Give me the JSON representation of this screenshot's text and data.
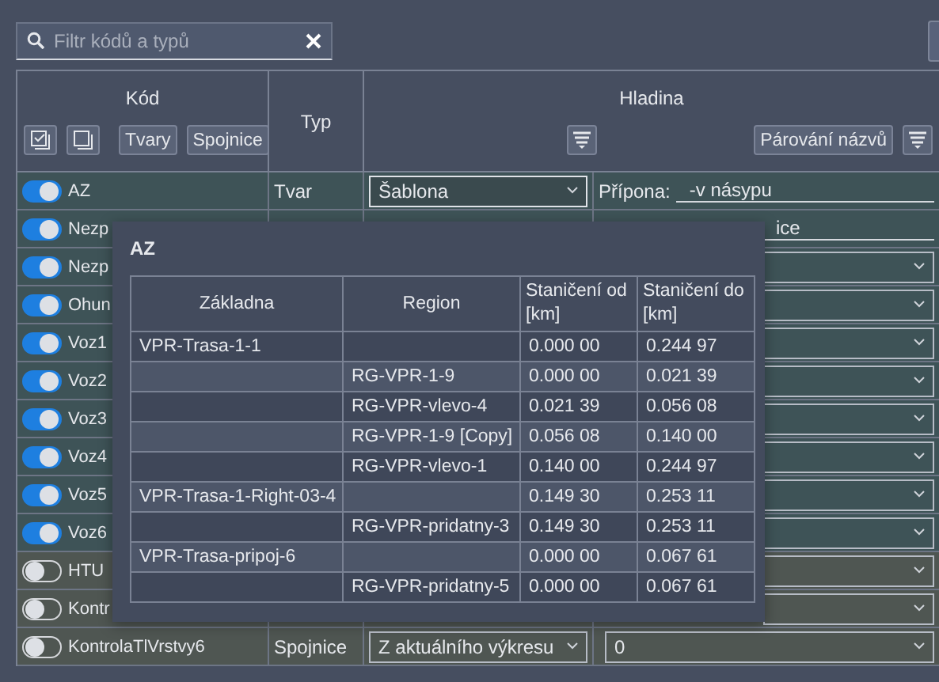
{
  "filter": {
    "placeholder": "Filtr kódů a typů"
  },
  "header": {
    "code": "Kód",
    "type": "Typ",
    "layer": "Hladina",
    "code_buttons": [
      "Tvary",
      "Spojnice"
    ],
    "pairing_button": "Párování názvů"
  },
  "rows": [
    {
      "name": "AZ",
      "on": true,
      "type": "Tvar",
      "layer": "Šablona",
      "right": {
        "kind": "suffix",
        "label": "Přípona:",
        "value": "-v násypu"
      }
    },
    {
      "name": "Nezp",
      "on": true,
      "right": {
        "kind": "text",
        "value": "ice"
      }
    },
    {
      "name": "Nezp",
      "on": true,
      "right": {
        "kind": "dropdown"
      }
    },
    {
      "name": "Ohun",
      "on": true,
      "right": {
        "kind": "dropdown"
      }
    },
    {
      "name": "Voz1",
      "on": true,
      "right": {
        "kind": "dropdown"
      }
    },
    {
      "name": "Voz2",
      "on": true,
      "right": {
        "kind": "dropdown"
      }
    },
    {
      "name": "Voz3",
      "on": true,
      "right": {
        "kind": "dropdown"
      }
    },
    {
      "name": "Voz4",
      "on": true,
      "right": {
        "kind": "dropdown"
      }
    },
    {
      "name": "Voz5",
      "on": true,
      "right": {
        "kind": "dropdown"
      }
    },
    {
      "name": "Voz6",
      "on": true,
      "right": {
        "kind": "dropdown"
      }
    },
    {
      "name": "HTU",
      "on": false,
      "right": {
        "kind": "dropdown"
      }
    },
    {
      "name": "Kontr",
      "on": false,
      "right": {
        "kind": "dropdown"
      }
    },
    {
      "name": "KontrolaTlVrstvy6",
      "on": false,
      "type": "Spojnice",
      "layer": "Z aktuálního výkresu",
      "right": {
        "kind": "dropdown",
        "value": "0"
      }
    }
  ],
  "popup": {
    "title": "AZ",
    "columns": [
      "Základna",
      "Region",
      "Staničení od [km]",
      "Staničení do [km]"
    ],
    "rows": [
      [
        "VPR-Trasa-1-1",
        "",
        "0.000 00",
        "0.244 97"
      ],
      [
        "",
        "RG-VPR-1-9",
        "0.000 00",
        "0.021 39"
      ],
      [
        "",
        "RG-VPR-vlevo-4",
        "0.021 39",
        "0.056 08"
      ],
      [
        "",
        "RG-VPR-1-9 [Copy]",
        "0.056 08",
        "0.140 00"
      ],
      [
        "",
        "RG-VPR-vlevo-1",
        "0.140 00",
        "0.244 97"
      ],
      [
        "VPR-Trasa-1-Right-03-4",
        "",
        "0.149 30",
        "0.253 11"
      ],
      [
        "",
        "RG-VPR-pridatny-3",
        "0.149 30",
        "0.253 11"
      ],
      [
        "VPR-Trasa-pripoj-6",
        "",
        "0.000 00",
        "0.067 61"
      ],
      [
        "",
        "RG-VPR-pridatny-5",
        "0.000 00",
        "0.067 61"
      ]
    ]
  }
}
